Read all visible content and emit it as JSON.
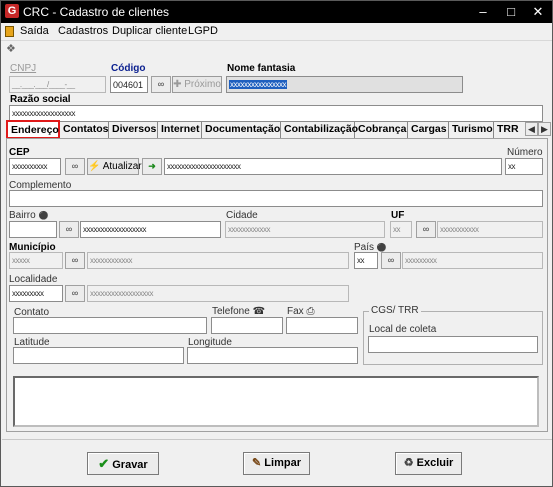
{
  "window": {
    "title": "CRC - Cadastro de clientes",
    "icon": "app-logo-icon"
  },
  "menu": [
    "Saída",
    "Cadastros",
    "Duplicar cliente",
    "LGPD"
  ],
  "header": {
    "cnpj_label": "CNPJ",
    "cnpj_value": "__.___.___/____-__",
    "codigo_label": "Código",
    "codigo_value": "004601",
    "proximo_label": "Próximo",
    "nome_fantasia_label": "Nome fantasia",
    "nome_fantasia_value": "xxxxxxxxxxxxxxxx",
    "razao_social_label": "Razão social",
    "razao_social_value": "xxxxxxxxxxxxxxxxxx"
  },
  "tabs": [
    "Endereço",
    "Contatos",
    "Diversos",
    "Internet",
    "Documentação",
    "Contabilização",
    "Cobrança",
    "Cargas",
    "Turismo",
    "TRR"
  ],
  "endereco": {
    "cep_label": "CEP",
    "cep_value": "xxxxxxxxxx",
    "atualizar_label": "Atualizar",
    "logradouro_value": "xxxxxxxxxxxxxxxxxxxxx",
    "numero_label": "Número",
    "numero_value": "xx",
    "complemento_label": "Complemento",
    "complemento_value": "",
    "bairro_label": "Bairro",
    "bairro_value": "xxxxxxxxxxxxxxxxxx",
    "cidade_label": "Cidade",
    "cidade_value": "xxxxxxxxxxxx",
    "uf_label": "UF",
    "uf_value": "xx",
    "uf_desc_value": "xxxxxxxxxxx",
    "municipio_label": "Município",
    "municipio_value": "xxxxx",
    "municipio_desc_value": "xxxxxxxxxxxx",
    "pais_label": "País",
    "pais_value": "xx",
    "pais_desc_value": "xxxxxxxxx",
    "localidade_label": "Localidade",
    "localidade_value": "xxxxxxxxx",
    "localidade_desc_value": "xxxxxxxxxxxxxxxxxx",
    "contato_label": "Contato",
    "telefone_label": "Telefone",
    "fax_label": "Fax",
    "latitude_label": "Latitude",
    "longitude_label": "Longitude",
    "cgs_group_label": "CGS/ TRR",
    "local_coleta_label": "Local de coleta"
  },
  "footer": {
    "gravar": "Gravar",
    "limpar": "Limpar",
    "excluir": "Excluir"
  }
}
